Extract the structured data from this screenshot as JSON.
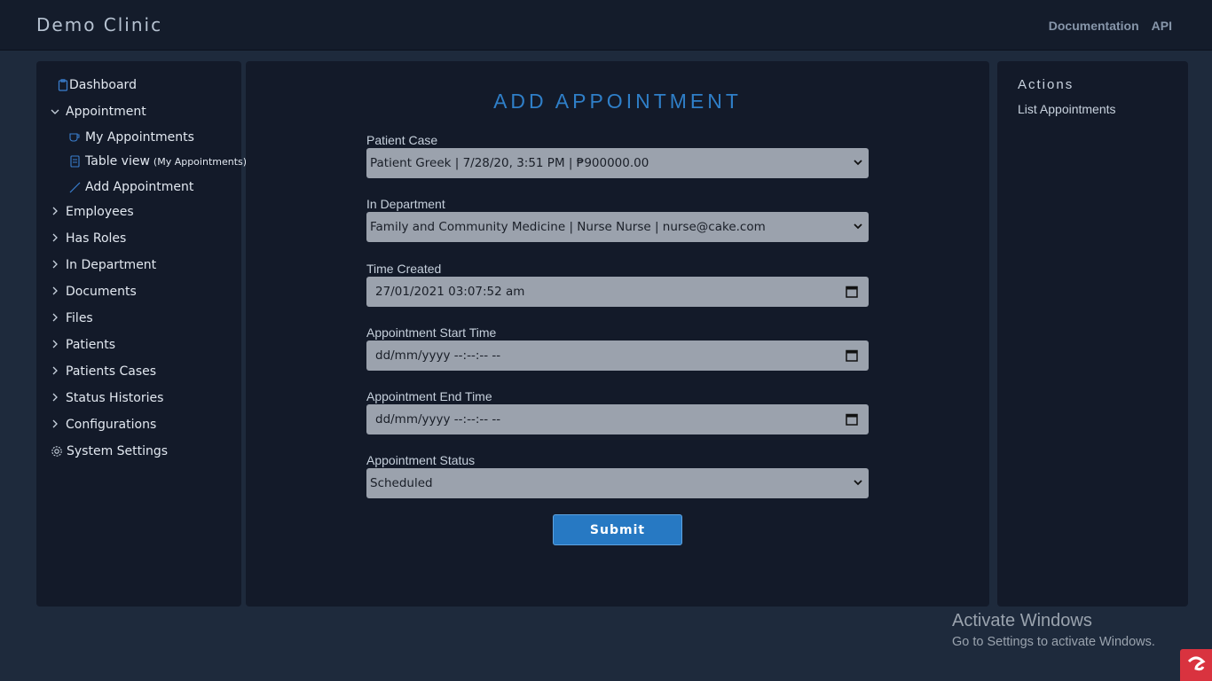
{
  "header": {
    "brand": "Demo Clinic",
    "links": [
      "Documentation",
      "API"
    ]
  },
  "sidebar": {
    "dashboard": "Dashboard",
    "appointment": "Appointment",
    "sub_items": [
      {
        "label": "My Appointments",
        "icon": "coffee-icon"
      },
      {
        "label": "Table view",
        "suffix": "(My Appointments)",
        "icon": "document-icon"
      },
      {
        "label": "Add Appointment",
        "icon": "pencil-icon"
      }
    ],
    "items": [
      "Employees",
      "Has Roles",
      "In Department",
      "Documents",
      "Files",
      "Patients",
      "Patients Cases",
      "Status Histories",
      "Configurations"
    ],
    "system_settings": "System Settings"
  },
  "form": {
    "title": "ADD APPOINTMENT",
    "patient_case_label": "Patient Case",
    "patient_case_value": "Patient Greek | 7/28/20, 3:51 PM | ₱900000.00",
    "department_label": "In Department",
    "department_value": "Family and Community Medicine | Nurse Nurse | nurse@cake.com",
    "time_created_label": "Time Created",
    "time_created_value": "27/01/2021 03:07:52 am",
    "start_label": "Appointment Start Time",
    "start_placeholder": "dd/mm/yyyy --:--:-- --",
    "end_label": "Appointment End Time",
    "end_placeholder": "dd/mm/yyyy --:--:-- --",
    "status_label": "Appointment Status",
    "status_value": "Scheduled",
    "submit_label": "Submit"
  },
  "actions": {
    "title": "Actions",
    "list_link": "List Appointments"
  },
  "watermark": {
    "line1": "Activate Windows",
    "line2": "Go to Settings to activate Windows."
  },
  "colors": {
    "accent": "#2f7fc8",
    "button": "#2779c3",
    "background": "#1e2a3c",
    "panel": "#131a29",
    "field": "#9ba2ad"
  }
}
